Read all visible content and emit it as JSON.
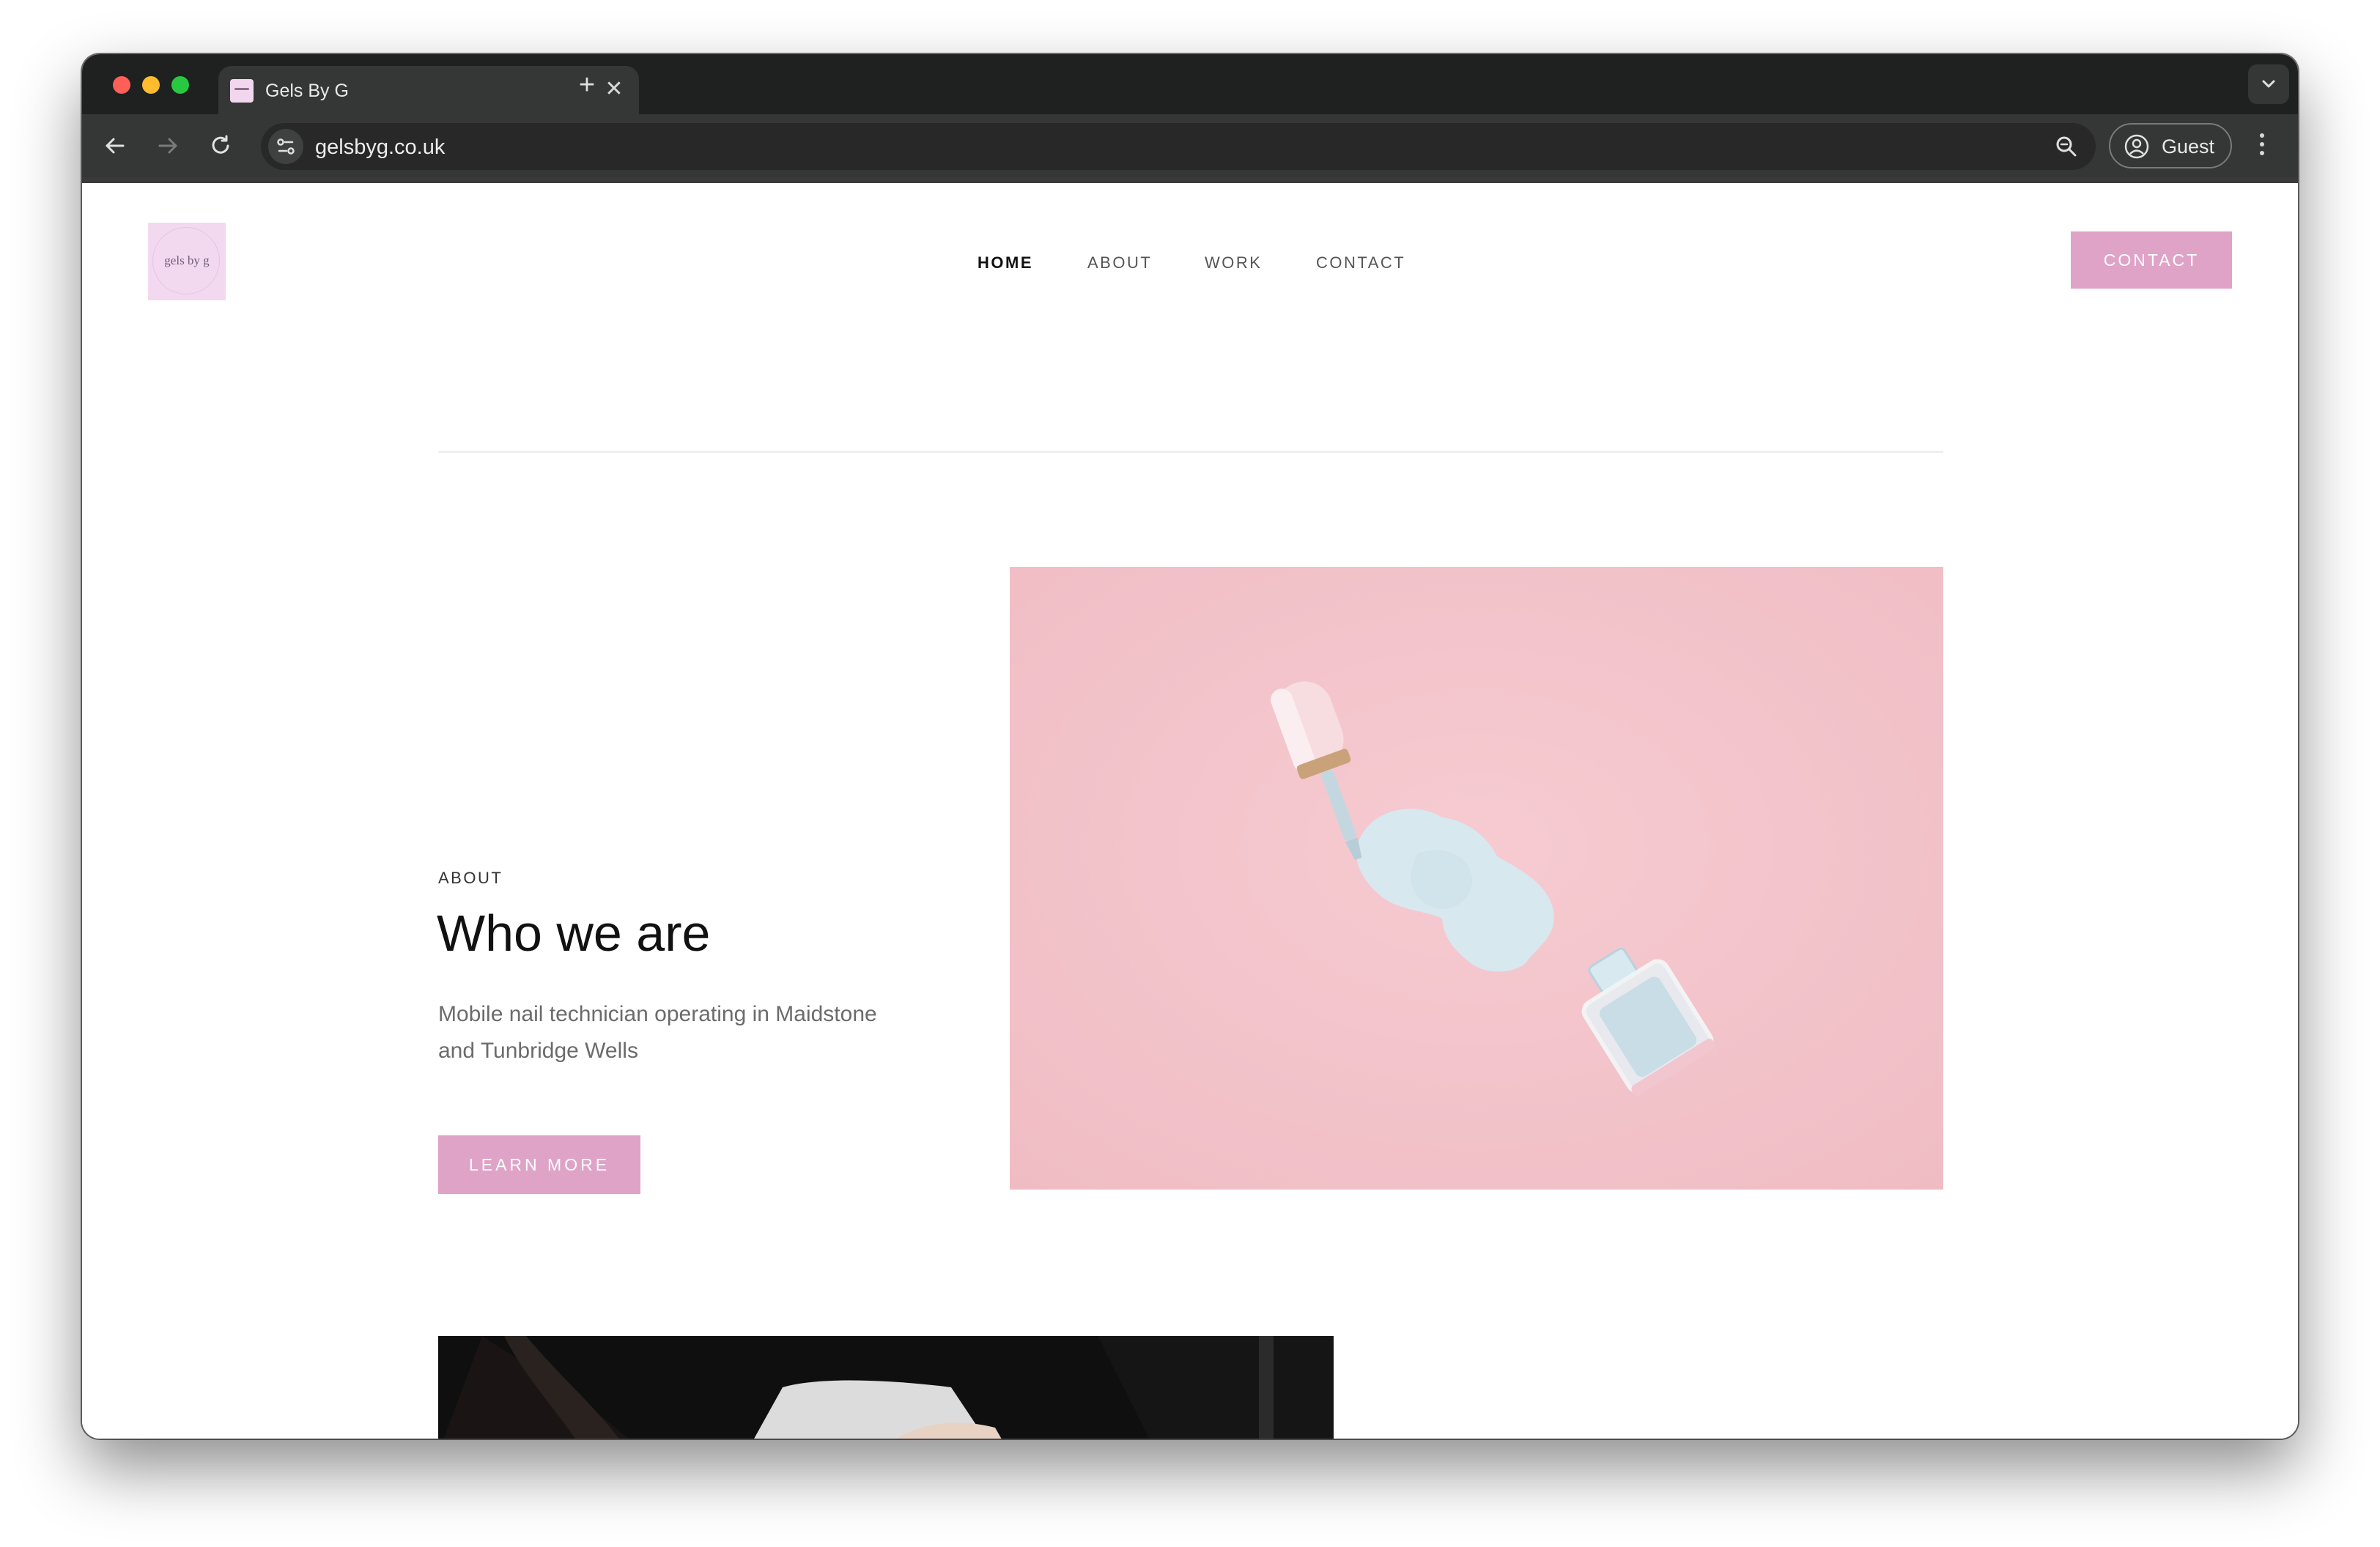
{
  "browser": {
    "tab_title": "Gels By G",
    "url": "gelsbyg.co.uk",
    "profile_label": "Guest"
  },
  "site": {
    "logo_text": "gels by g",
    "nav": [
      "HOME",
      "ABOUT",
      "WORK",
      "CONTACT"
    ],
    "active_nav": "HOME",
    "header_button": "CONTACT"
  },
  "about": {
    "eyebrow": "ABOUT",
    "heading": "Who we are",
    "description": "Mobile nail technician operating in Maidstone and Tunbridge Wells",
    "button": "LEARN MORE"
  },
  "colors": {
    "accent": "#dfa3c8",
    "hero_background": "#f4c3ca",
    "browser_frame": "#1f2020"
  }
}
